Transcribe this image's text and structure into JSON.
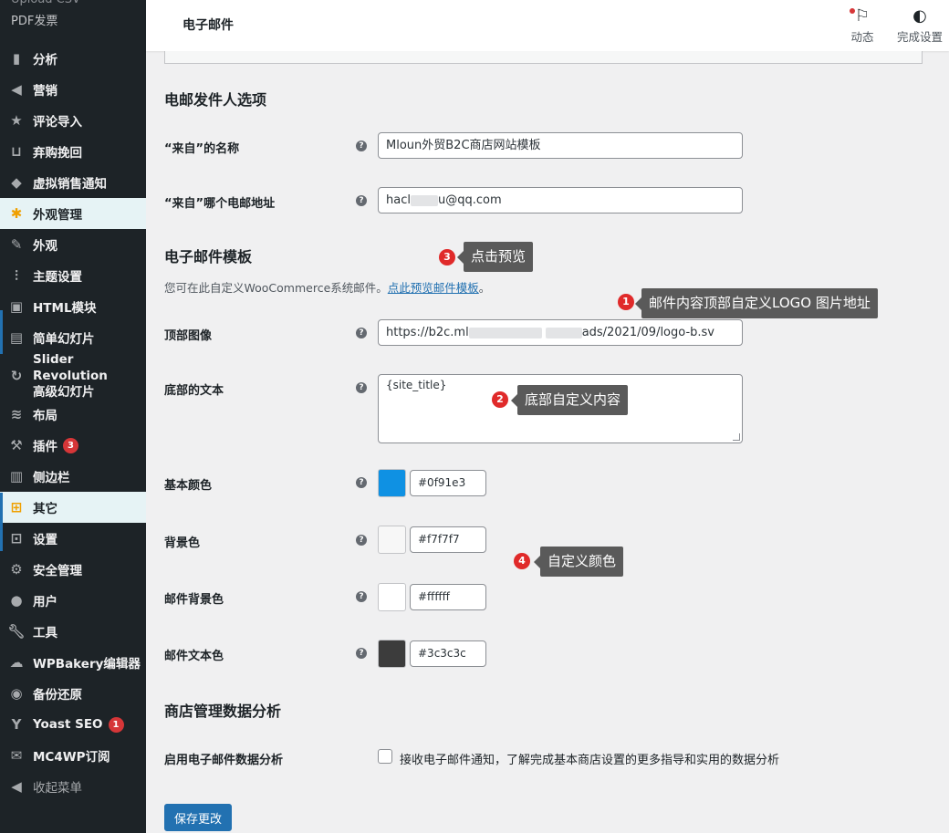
{
  "sidebar": {
    "top_items": [
      "Upload CSV",
      "PDF发票"
    ],
    "items": [
      {
        "label": "分析",
        "icon": "chart-bar-icon"
      },
      {
        "label": "营销",
        "icon": "megaphone-icon"
      },
      {
        "label": "评论导入",
        "icon": "star-icon"
      },
      {
        "label": "弃购挽回",
        "icon": "cart-icon"
      },
      {
        "label": "虚拟销售通知",
        "icon": "tag-icon"
      },
      {
        "label": "外观管理",
        "icon": "palm-icon"
      },
      {
        "label": "外观",
        "icon": "brush-icon"
      },
      {
        "label": "主题设置",
        "icon": "sliders-icon"
      },
      {
        "label": "HTML模块",
        "icon": "code-icon"
      },
      {
        "label": "简单幻灯片",
        "icon": "slides-icon"
      },
      {
        "label": "Slider Revolution\n高级幻灯片",
        "icon": "refresh-icon"
      },
      {
        "label": "布局",
        "icon": "layers-icon"
      },
      {
        "label": "插件",
        "icon": "plugin-icon",
        "badge": "3"
      },
      {
        "label": "侧边栏",
        "icon": "sidebar-icon"
      },
      {
        "label": "其它",
        "icon": "grid-icon"
      },
      {
        "label": "设置",
        "icon": "settings-icon"
      },
      {
        "label": "安全管理",
        "icon": "shield-icon"
      },
      {
        "label": "用户",
        "icon": "user-icon"
      },
      {
        "label": "工具",
        "icon": "wrench-icon"
      },
      {
        "label": "WPBakery编辑器",
        "icon": "cloud-icon"
      },
      {
        "label": "备份还原",
        "icon": "backup-icon"
      },
      {
        "label": "Yoast SEO",
        "icon": "yoast-icon",
        "badge": "1"
      },
      {
        "label": "MC4WP订阅",
        "icon": "mailchimp-icon"
      },
      {
        "label": "收起菜单",
        "icon": "collapse-icon"
      }
    ]
  },
  "topbar": {
    "title": "电子邮件",
    "activity_label": "动态",
    "setup_label": "完成设置"
  },
  "sender": {
    "heading": "电邮发件人选项",
    "from_name_label": "“来自”的名称",
    "from_name_value": "Mloun外贸B2C商店网站模板",
    "from_email_label": "“来自”哪个电邮地址",
    "from_email_prefix": "hacl",
    "from_email_suffix": "u@qq.com"
  },
  "template": {
    "heading": "电子邮件模板",
    "desc_text": "您可在此自定义WooCommerce系统邮件。",
    "desc_link": "点此预览邮件模板",
    "desc_end": "。",
    "header_image_label": "顶部图像",
    "header_image_value_a": "https://b2c.ml",
    "header_image_value_b": "ads/2021/09/logo-b.sv",
    "footer_text_label": "底部的文本",
    "footer_text_value": "{site_title}",
    "base_color_label": "基本颜色",
    "base_color": "#0f91e3",
    "bg_color_label": "背景色",
    "bg_color": "#f7f7f7",
    "body_bg_label": "邮件背景色",
    "body_bg_color": "#ffffff",
    "body_text_label": "邮件文本色",
    "body_text_color": "#3c3c3c"
  },
  "analytics": {
    "heading": "商店管理数据分析",
    "enable_label": "启用电子邮件数据分析",
    "checkbox_text": "接收电子邮件通知，了解完成基本商店设置的更多指导和实用的数据分析",
    "checked": false
  },
  "save_button": "保存更改",
  "annotations": [
    {
      "num": "1",
      "text": "邮件内容顶部自定义LOGO 图片地址"
    },
    {
      "num": "2",
      "text": "底部自定义内容"
    },
    {
      "num": "3",
      "text": "点击预览"
    },
    {
      "num": "4",
      "text": "自定义颜色"
    }
  ]
}
